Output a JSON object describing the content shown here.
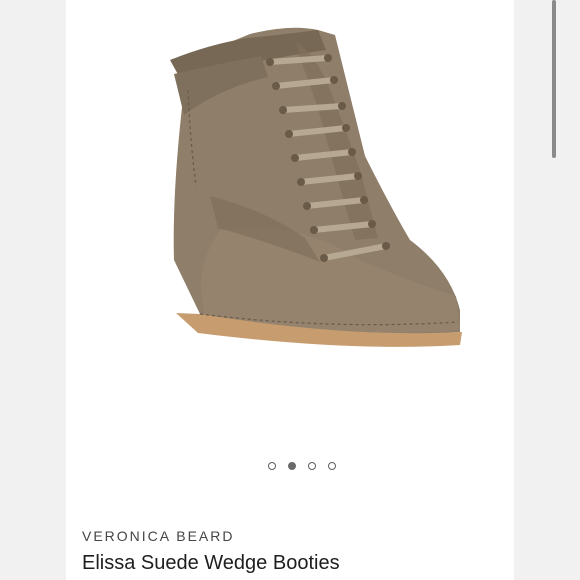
{
  "carousel": {
    "image_alt": "suede-wedge-sneaker-bootie",
    "slides": 4,
    "active_index": 1
  },
  "product": {
    "brand": "VERONICA BEARD",
    "title": "Elissa Suede Wedge Booties"
  },
  "colors": {
    "suede": "#8f7f6b",
    "sole": "#c69a6d"
  }
}
